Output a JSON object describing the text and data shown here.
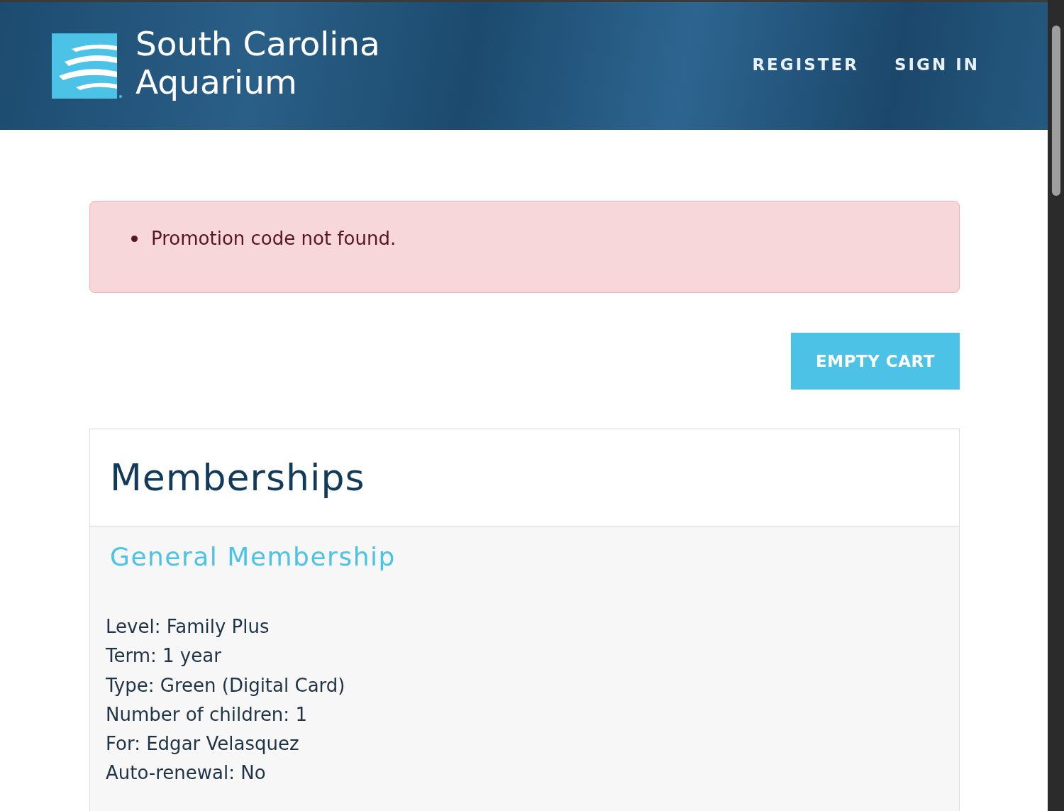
{
  "header": {
    "logo_lines": [
      "South Carolina",
      "Aquarium"
    ],
    "nav": [
      "REGISTER",
      "SIGN IN"
    ]
  },
  "alert": {
    "messages": [
      "Promotion code not found."
    ]
  },
  "empty_cart_button": "EMPTY CART",
  "card": {
    "title": "Memberships",
    "items": [
      {
        "name": "General Membership",
        "details": [
          "Level: Family Plus",
          "Term: 1 year",
          "Type: Green (Digital Card)",
          "Number of children: 1",
          "For: Edgar Velasquez",
          "Auto-renewal: No"
        ]
      }
    ]
  }
}
